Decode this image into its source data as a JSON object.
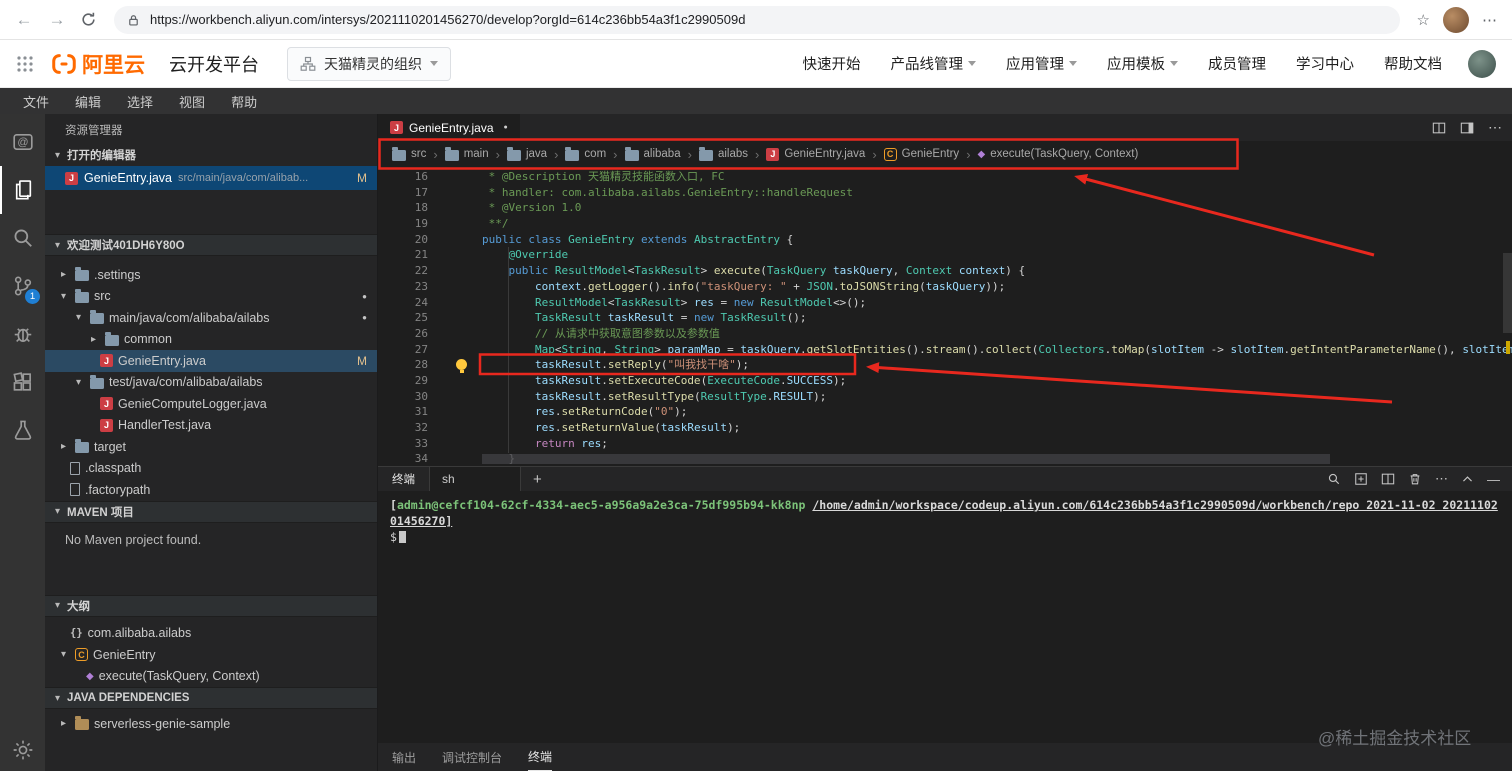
{
  "browser": {
    "url": "https://workbench.aliyun.com/intersys/2021110201456270/develop?orgId=614c236bb54a3f1c2990509d"
  },
  "topnav": {
    "brand": "阿里云",
    "product": "云开发平台",
    "org": "天猫精灵的组织",
    "menu": [
      {
        "label": "快速开始",
        "dropdown": false
      },
      {
        "label": "产品线管理",
        "dropdown": true
      },
      {
        "label": "应用管理",
        "dropdown": true
      },
      {
        "label": "应用模板",
        "dropdown": true
      },
      {
        "label": "成员管理",
        "dropdown": false
      },
      {
        "label": "学习中心",
        "dropdown": false
      },
      {
        "label": "帮助文档",
        "dropdown": false
      }
    ]
  },
  "menubar": {
    "items": [
      "文件",
      "编辑",
      "选择",
      "视图",
      "帮助"
    ]
  },
  "activitybar": {
    "scm_badge": "1"
  },
  "sidebar": {
    "title": "资源管理器",
    "open_editors": {
      "header": "打开的编辑器",
      "file": "GenieEntry.java",
      "path": "src/main/java/com/alibab...",
      "badge": "M"
    },
    "project": {
      "header": "欢迎测试401DH6Y80O"
    },
    "tree": [
      {
        "label": ".settings",
        "icon": "folder",
        "chev": "right",
        "level": 0
      },
      {
        "label": "src",
        "icon": "folder",
        "chev": "down",
        "level": 0,
        "dot": true
      },
      {
        "label": "main/java/com/alibaba/ailabs",
        "icon": "folder",
        "chev": "down",
        "level": 1,
        "dot": true
      },
      {
        "label": "common",
        "icon": "folder",
        "chev": "right",
        "level": 2
      },
      {
        "label": "GenieEntry.java",
        "icon": "java",
        "level": 2,
        "badge": "M",
        "selected": true
      },
      {
        "label": "test/java/com/alibaba/ailabs",
        "icon": "folder",
        "chev": "down",
        "level": 1
      },
      {
        "label": "GenieComputeLogger.java",
        "icon": "java",
        "level": 2
      },
      {
        "label": "HandlerTest.java",
        "icon": "java",
        "level": 2
      },
      {
        "label": "target",
        "icon": "folder",
        "chev": "right",
        "level": 0
      },
      {
        "label": ".classpath",
        "icon": "file",
        "level": 0
      },
      {
        "label": ".factorypath",
        "icon": "file",
        "level": 0
      }
    ],
    "maven": {
      "header": "MAVEN 项目",
      "empty": "No Maven project found."
    },
    "outline": {
      "header": "大纲",
      "items": [
        {
          "label": "com.alibaba.ailabs",
          "icon": "namespace",
          "level": 0
        },
        {
          "label": "GenieEntry",
          "icon": "class",
          "chev": "down",
          "level": 0
        },
        {
          "label": "execute(TaskQuery, Context)",
          "icon": "method",
          "level": 1
        }
      ]
    },
    "deps": {
      "header": "JAVA DEPENDENCIES",
      "items": [
        {
          "label": "serverless-genie-sample",
          "icon": "folder",
          "chev": "right",
          "level": 0
        }
      ]
    }
  },
  "editor": {
    "tab": "GenieEntry.java",
    "breadcrumb": [
      {
        "label": "src",
        "icon": "folder"
      },
      {
        "label": "main",
        "icon": "folder"
      },
      {
        "label": "java",
        "icon": "folder"
      },
      {
        "label": "com",
        "icon": "folder"
      },
      {
        "label": "alibaba",
        "icon": "folder"
      },
      {
        "label": "ailabs",
        "icon": "folder"
      },
      {
        "label": "GenieEntry.java",
        "icon": "java"
      },
      {
        "label": "GenieEntry",
        "icon": "class"
      },
      {
        "label": "execute(TaskQuery, Context)",
        "icon": "method"
      }
    ],
    "code_lines": [
      {
        "n": 16,
        "t": [
          [
            "cm",
            " * @Description 天猫精灵技能函数入口, FC"
          ]
        ]
      },
      {
        "n": 17,
        "t": [
          [
            "cm",
            " * handler: com.alibaba.ailabs.GenieEntry::handleRequest"
          ]
        ]
      },
      {
        "n": 18,
        "t": [
          [
            "cm",
            " * @Version 1.0"
          ]
        ]
      },
      {
        "n": 19,
        "t": [
          [
            "cm",
            " **/"
          ]
        ]
      },
      {
        "n": 20,
        "t": [
          [
            "kw",
            "public "
          ],
          [
            "kw",
            "class "
          ],
          [
            "cls",
            "GenieEntry "
          ],
          [
            "kw",
            "extends "
          ],
          [
            "cls",
            "AbstractEntry "
          ],
          [
            "pn",
            "{"
          ]
        ]
      },
      {
        "n": 21,
        "t": [
          [
            "pn",
            "    "
          ],
          [
            "ann",
            "@Override"
          ]
        ]
      },
      {
        "n": 22,
        "t": [
          [
            "pn",
            "    "
          ],
          [
            "kw",
            "public "
          ],
          [
            "cls",
            "ResultModel"
          ],
          [
            "pn",
            "<"
          ],
          [
            "cls",
            "TaskResult"
          ],
          [
            "pn",
            "> "
          ],
          [
            "fn",
            "execute"
          ],
          [
            "pn",
            "("
          ],
          [
            "cls",
            "TaskQuery "
          ],
          [
            "var",
            "taskQuery"
          ],
          [
            "pn",
            ", "
          ],
          [
            "cls",
            "Context "
          ],
          [
            "var",
            "context"
          ],
          [
            "pn",
            ") {"
          ]
        ]
      },
      {
        "n": 23,
        "t": [
          [
            "pn",
            "        "
          ],
          [
            "var",
            "context"
          ],
          [
            "pn",
            "."
          ],
          [
            "fn",
            "getLogger"
          ],
          [
            "pn",
            "()."
          ],
          [
            "fn",
            "info"
          ],
          [
            "pn",
            "("
          ],
          [
            "str",
            "\"taskQuery: \""
          ],
          [
            "pn",
            " + "
          ],
          [
            "cls",
            "JSON"
          ],
          [
            "pn",
            "."
          ],
          [
            "fn",
            "toJSONString"
          ],
          [
            "pn",
            "("
          ],
          [
            "var",
            "taskQuery"
          ],
          [
            "pn",
            "));"
          ]
        ]
      },
      {
        "n": 24,
        "t": [
          [
            "pn",
            "        "
          ],
          [
            "cls",
            "ResultModel"
          ],
          [
            "pn",
            "<"
          ],
          [
            "cls",
            "TaskResult"
          ],
          [
            "pn",
            "> "
          ],
          [
            "var",
            "res"
          ],
          [
            "pn",
            " = "
          ],
          [
            "kw",
            "new "
          ],
          [
            "cls",
            "ResultModel"
          ],
          [
            "pn",
            "<>();"
          ]
        ]
      },
      {
        "n": 25,
        "t": [
          [
            "pn",
            "        "
          ],
          [
            "cls",
            "TaskResult "
          ],
          [
            "var",
            "taskResult"
          ],
          [
            "pn",
            " = "
          ],
          [
            "kw",
            "new "
          ],
          [
            "cls",
            "TaskResult"
          ],
          [
            "pn",
            "();"
          ]
        ]
      },
      {
        "n": 26,
        "t": [
          [
            "pn",
            "        "
          ],
          [
            "cm",
            "// 从请求中获取意图参数以及参数值"
          ]
        ]
      },
      {
        "n": 27,
        "t": [
          [
            "pn",
            "        "
          ],
          [
            "cls",
            "Map"
          ],
          [
            "pn",
            "<"
          ],
          [
            "cls",
            "String"
          ],
          [
            "pn",
            ", "
          ],
          [
            "cls",
            "String"
          ],
          [
            "pn",
            "> "
          ],
          [
            "var",
            "paramMap"
          ],
          [
            "pn",
            " = "
          ],
          [
            "var",
            "taskQuery"
          ],
          [
            "pn",
            "."
          ],
          [
            "fn",
            "getSlotEntities"
          ],
          [
            "pn",
            "()."
          ],
          [
            "fn",
            "stream"
          ],
          [
            "pn",
            "()."
          ],
          [
            "fn",
            "collect"
          ],
          [
            "pn",
            "("
          ],
          [
            "cls",
            "Collectors"
          ],
          [
            "pn",
            "."
          ],
          [
            "fn",
            "toMap"
          ],
          [
            "pn",
            "("
          ],
          [
            "var",
            "slotItem"
          ],
          [
            "pn",
            " -> "
          ],
          [
            "var",
            "slotItem"
          ],
          [
            "pn",
            "."
          ],
          [
            "fn",
            "getIntentParameterName"
          ],
          [
            "pn",
            "(), "
          ],
          [
            "var",
            "slotItem"
          ],
          [
            "pn",
            " -> "
          ],
          [
            "var",
            "slo"
          ]
        ]
      },
      {
        "n": 28,
        "bulb": true,
        "t": [
          [
            "pn",
            "        "
          ],
          [
            "var",
            "taskResult"
          ],
          [
            "pn",
            "."
          ],
          [
            "fn",
            "setReply"
          ],
          [
            "pn",
            "("
          ],
          [
            "str",
            "\"叫我找干啥\""
          ],
          [
            "pn",
            ");"
          ]
        ]
      },
      {
        "n": 29,
        "t": [
          [
            "pn",
            "        "
          ],
          [
            "var",
            "taskResult"
          ],
          [
            "pn",
            "."
          ],
          [
            "fn",
            "setExecuteCode"
          ],
          [
            "pn",
            "("
          ],
          [
            "cls",
            "ExecuteCode"
          ],
          [
            "pn",
            "."
          ],
          [
            "var",
            "SUCCESS"
          ],
          [
            "pn",
            ");"
          ]
        ]
      },
      {
        "n": 30,
        "t": [
          [
            "pn",
            "        "
          ],
          [
            "var",
            "taskResult"
          ],
          [
            "pn",
            "."
          ],
          [
            "fn",
            "setResultType"
          ],
          [
            "pn",
            "("
          ],
          [
            "cls",
            "ResultType"
          ],
          [
            "pn",
            "."
          ],
          [
            "var",
            "RESULT"
          ],
          [
            "pn",
            ");"
          ]
        ]
      },
      {
        "n": 31,
        "t": [
          [
            "pn",
            "        "
          ],
          [
            "var",
            "res"
          ],
          [
            "pn",
            "."
          ],
          [
            "fn",
            "setReturnCode"
          ],
          [
            "pn",
            "("
          ],
          [
            "str",
            "\"0\""
          ],
          [
            "pn",
            ");"
          ]
        ]
      },
      {
        "n": 32,
        "t": [
          [
            "pn",
            "        "
          ],
          [
            "var",
            "res"
          ],
          [
            "pn",
            "."
          ],
          [
            "fn",
            "setReturnValue"
          ],
          [
            "pn",
            "("
          ],
          [
            "var",
            "taskResult"
          ],
          [
            "pn",
            ");"
          ]
        ]
      },
      {
        "n": 33,
        "t": [
          [
            "pn",
            "        "
          ],
          [
            "ctrl",
            "return "
          ],
          [
            "var",
            "res"
          ],
          [
            "pn",
            ";"
          ]
        ]
      },
      {
        "n": 34,
        "t": [
          [
            "pn",
            "    }"
          ]
        ]
      }
    ]
  },
  "terminal": {
    "title": "终端",
    "tab": "sh",
    "new_label": "+",
    "ps1": [
      {
        "text": "[",
        "style": "plain"
      },
      {
        "text": "admin@cefcf104-62cf-4334-aec5-a956a9a2e3ca-75df995b94-kk8np",
        "style": "user"
      },
      {
        "text": " ",
        "style": "plain"
      },
      {
        "text": "/home/admin/workspace/codeup.aliyun.com/614c236bb54a3f1c2990509d/workbench/repo 2021-11-02 2021110201456270]",
        "style": "path"
      }
    ],
    "prompt": "$"
  },
  "panelbar": {
    "items": [
      {
        "label": "输出",
        "active": false
      },
      {
        "label": "调试控制台",
        "active": false
      },
      {
        "label": "终端",
        "active": true
      }
    ]
  },
  "watermark": "@稀土掘金技术社区",
  "colors": {
    "accent": "#ff6a00",
    "annotation": "#e8281e",
    "badge_blue": "#1f7fd4",
    "modified": "#e2c08d"
  }
}
